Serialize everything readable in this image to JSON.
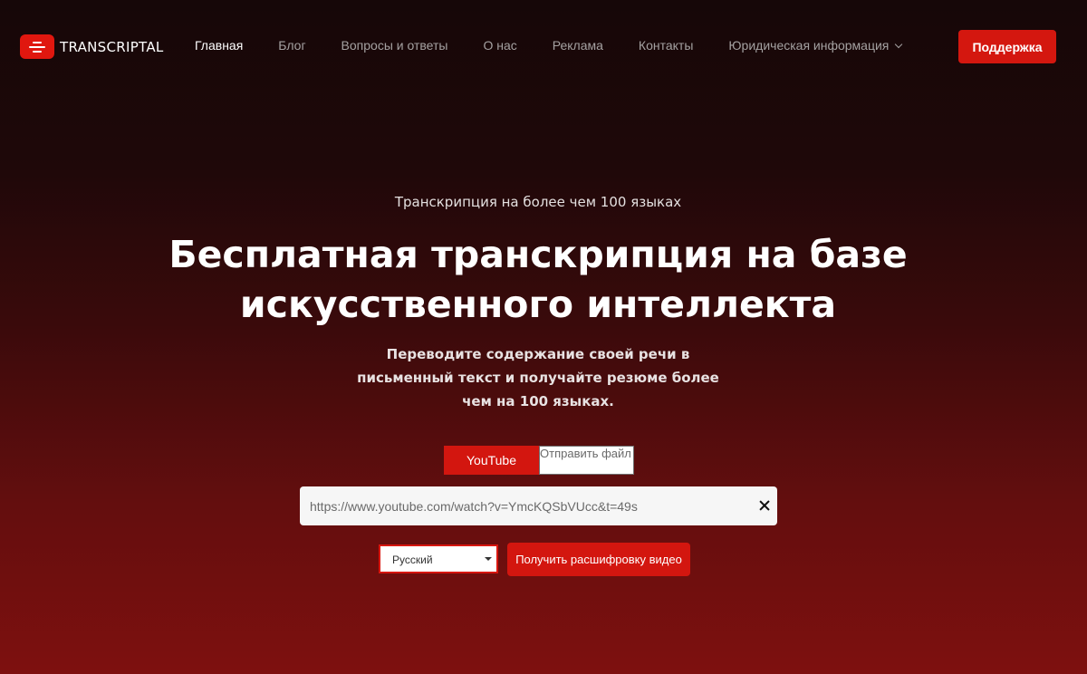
{
  "brand": {
    "name": "TRANSCRIPTAL",
    "accent_color": "#e0170f"
  },
  "nav": {
    "items": [
      {
        "label": "Главная",
        "active": true
      },
      {
        "label": "Блог",
        "active": false
      },
      {
        "label": "Вопросы и ответы",
        "active": false
      },
      {
        "label": "О нас",
        "active": false
      },
      {
        "label": "Реклама",
        "active": false
      },
      {
        "label": "Контакты",
        "active": false
      },
      {
        "label": "Юридическая информация",
        "active": false,
        "dropdown": true
      }
    ],
    "support_label": "Поддержка"
  },
  "hero": {
    "subtitle": "Транскрипция на более чем 100 языках",
    "headline_line1": "Бесплатная транскрипция на базе",
    "headline_line2": "искусственного интеллекта",
    "description_line1": "Переводите содержание своей речи в",
    "description_line2": "письменный текст и получайте резюме более",
    "description_line3": "чем на 100 языках."
  },
  "source_tabs": {
    "youtube_label": "YouTube",
    "file_label": "Отправить файл",
    "selected": "YouTube"
  },
  "url_input": {
    "value": "https://www.youtube.com/watch?v=YmcKQSbVUcc&t=49s"
  },
  "language_select": {
    "selected": "Русский"
  },
  "submit": {
    "label": "Получить расшифровку видео"
  },
  "icons": {
    "logo": "transcript-lines-icon",
    "dropdown": "chevron-down-icon",
    "clear": "close-icon",
    "select_arrow": "caret-down-icon"
  }
}
